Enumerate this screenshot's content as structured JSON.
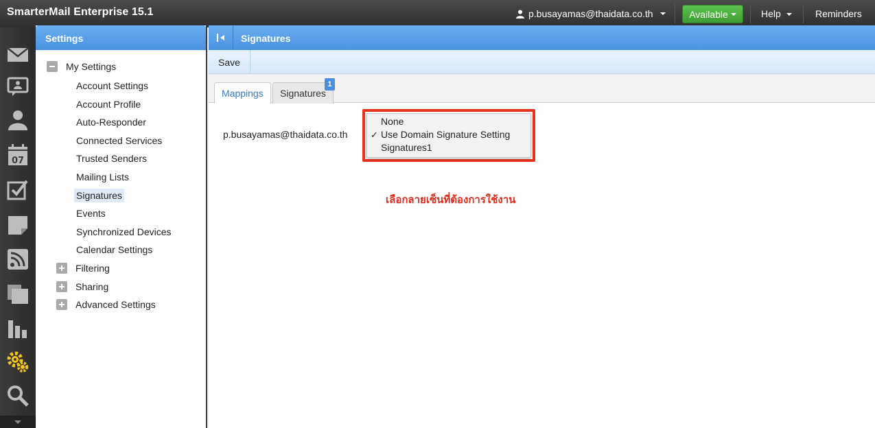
{
  "app": {
    "title": "SmarterMail Enterprise 15.1"
  },
  "topbar": {
    "user": "p.busayamas@thaidata.co.th",
    "status": "Available",
    "help": "Help",
    "reminders": "Reminders"
  },
  "rail": {
    "icons": [
      "mail-icon",
      "chat-icon",
      "contacts-icon",
      "calendar-icon",
      "tasks-icon",
      "notes-icon",
      "rss-icon",
      "files-icon",
      "reports-icon",
      "settings-icon",
      "search-icon"
    ],
    "calendar_day": "07",
    "accent": "#f5c518"
  },
  "settings_panel": {
    "title": "Settings",
    "groups": [
      {
        "label": "My Settings",
        "expanded": true,
        "children": [
          "Account Settings",
          "Account Profile",
          "Auto-Responder",
          "Connected Services",
          "Trusted Senders",
          "Mailing Lists",
          "Signatures",
          "Events",
          "Synchronized Devices",
          "Calendar Settings"
        ]
      },
      {
        "label": "Filtering",
        "expanded": false
      },
      {
        "label": "Sharing",
        "expanded": false
      },
      {
        "label": "Advanced Settings",
        "expanded": false
      }
    ],
    "selected": "Signatures"
  },
  "main": {
    "title": "Signatures",
    "toolbar": {
      "save": "Save"
    },
    "tabs": [
      {
        "label": "Mappings",
        "active": true
      },
      {
        "label": "Signatures",
        "active": false,
        "badge": "1"
      }
    ],
    "mapping": {
      "email": "p.busayamas@thaidata.co.th",
      "options": [
        "None",
        "Use Domain Signature Setting",
        "Signatures1"
      ],
      "selected_option": "Use Domain Signature Setting",
      "check_mark": "✓"
    },
    "annotation": "เลือกลายเซ็นที่ต้องการใช้งาน"
  },
  "colors": {
    "header_blue": "#4a92df",
    "available_green": "#4caf3f",
    "highlight_red": "#e8331e"
  }
}
